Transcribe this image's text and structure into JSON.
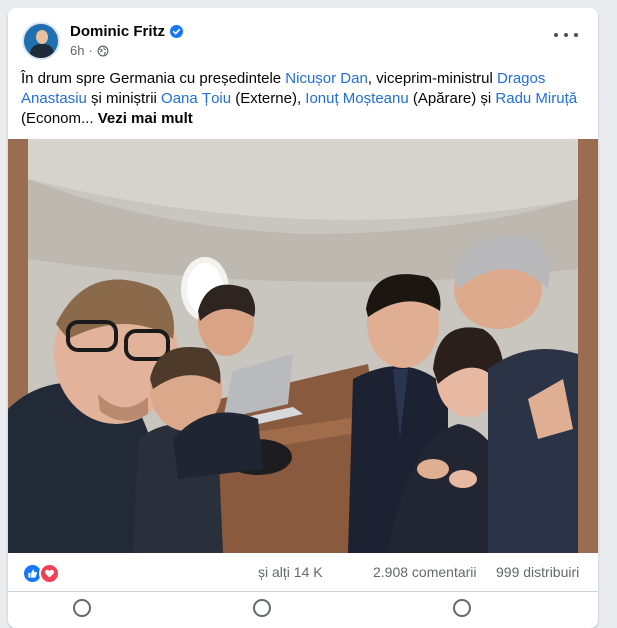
{
  "post": {
    "author": "Dominic Fritz",
    "time": "6h",
    "separator": "·",
    "caption": [
      {
        "t": "În drum spre Germania cu președintele ",
        "tag": false
      },
      {
        "t": "Nicușor Dan",
        "tag": true
      },
      {
        "t": ", viceprim-ministrul ",
        "tag": false
      },
      {
        "t": "Dragos Anastasiu",
        "tag": true
      },
      {
        "t": " și miniștrii ",
        "tag": false
      },
      {
        "t": "Oana Țoiu",
        "tag": true
      },
      {
        "t": " (Externe), ",
        "tag": false
      },
      {
        "t": "Ionuț Moșteanu",
        "tag": true
      },
      {
        "t": " (Apărare) și ",
        "tag": false
      },
      {
        "t": "Radu Miruță",
        "tag": true
      },
      {
        "t": " (Econom... ",
        "tag": false
      }
    ],
    "see_more": "Vezi mai mult"
  },
  "stats": {
    "others": "și alți 14 K",
    "comments": "2.908 comentarii",
    "shares": "999 distribuiri"
  },
  "icons": {
    "verified": "verified-badge-icon",
    "audience": "globe-icon",
    "menu": "more-options-icon",
    "like": "like-reaction-icon",
    "love": "love-reaction-icon"
  },
  "colors": {
    "tag": "#216fdb",
    "like": "#1877f2",
    "love": "#f33e58"
  }
}
